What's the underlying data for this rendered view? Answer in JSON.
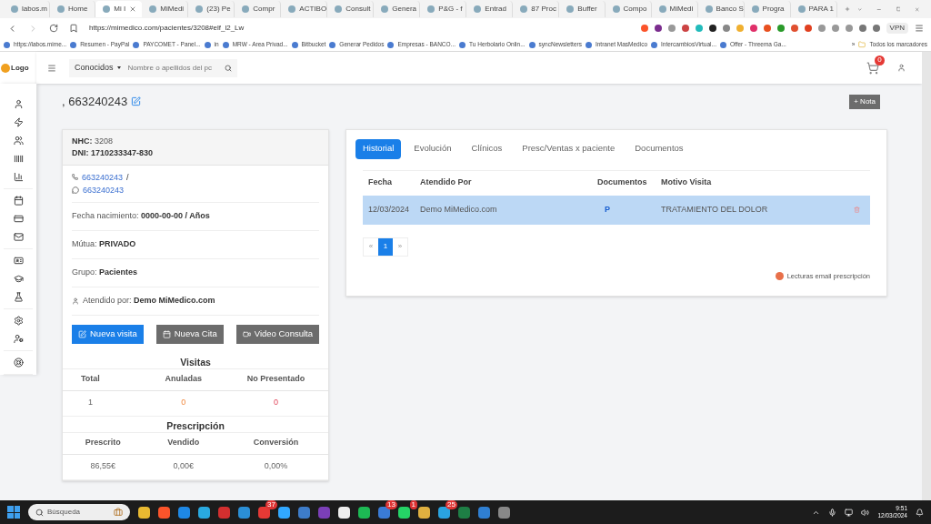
{
  "browser": {
    "tabs": [
      {
        "label": "labos.m",
        "selected": false
      },
      {
        "label": "Home",
        "selected": false
      },
      {
        "label": "Mi I",
        "selected": true
      },
      {
        "label": "MiMedi",
        "selected": false
      },
      {
        "label": "(23) Pe",
        "selected": false
      },
      {
        "label": "Compr",
        "selected": false
      },
      {
        "label": "ACTIBO",
        "selected": false
      },
      {
        "label": "Consult",
        "selected": false
      },
      {
        "label": "Genera",
        "selected": false
      },
      {
        "label": "P&G - f",
        "selected": false
      },
      {
        "label": "Entrad",
        "selected": false
      },
      {
        "label": "87 Proc",
        "selected": false
      },
      {
        "label": "Buffer",
        "selected": false
      },
      {
        "label": "Compo",
        "selected": false
      },
      {
        "label": "MiMedi",
        "selected": false
      },
      {
        "label": "Banco S",
        "selected": false
      },
      {
        "label": "Progra",
        "selected": false
      },
      {
        "label": "PARA 1",
        "selected": false
      }
    ],
    "url": "https://mimedico.com/pacientes/3208#elf_l2_Lw",
    "vpn": "VPN",
    "bookmarks": [
      {
        "label": "https://labos.mime..."
      },
      {
        "label": "Resumen - PayPal"
      },
      {
        "label": "PAYCOMET - Panel..."
      },
      {
        "label": "in"
      },
      {
        "label": "MRW - Area Privad..."
      },
      {
        "label": "Bitbucket"
      },
      {
        "label": "Generar Pedidos"
      },
      {
        "label": "Empresas - BANCO..."
      },
      {
        "label": "Tu Herbolario Onlin..."
      },
      {
        "label": "syncNewsletters"
      },
      {
        "label": "Intranet MasMedico"
      },
      {
        "label": "IntercambiosVirtual..."
      },
      {
        "label": "Offer - Threema Ga..."
      }
    ],
    "more": "»",
    "all_bookmarks": "Todos los marcadores"
  },
  "app": {
    "logo": "Logo",
    "filter": "Conocidos",
    "search_placeholder": "Nombre o apellidos del pc",
    "cart_badge": "0",
    "title": ", 663240243",
    "note_button": "+ Nota",
    "patient": {
      "nhc_label": "NHC:",
      "nhc": "3208",
      "dni": "DNI: 1710233347-830",
      "phone": "663240243",
      "separator": "/",
      "whatsapp": "663240243",
      "fields": [
        {
          "label": "Fecha nacimiento:",
          "value": "0000-00-00 / Años"
        },
        {
          "label": "Mútua:",
          "value": "PRIVADO"
        },
        {
          "label": "Grupo:",
          "value": "Pacientes"
        },
        {
          "label": "Atendido por:",
          "value": "Demo MiMedico.com"
        }
      ],
      "buttons": [
        {
          "label": "Nueva visita",
          "kind": "primary"
        },
        {
          "label": "Nueva Cita",
          "kind": "calendar"
        },
        {
          "label": "Video Consulta",
          "kind": "video"
        }
      ]
    },
    "stats": [
      {
        "title": "Visitas",
        "columns": [
          "Total",
          "Anuladas",
          "No Presentado"
        ],
        "values": [
          {
            "text": "1",
            "kind": "neutral"
          },
          {
            "text": "0",
            "kind": "cancelled"
          },
          {
            "text": "0",
            "kind": "missed"
          }
        ]
      },
      {
        "title": "Prescripción",
        "columns": [
          "Prescrito",
          "Vendido",
          "Conversión"
        ],
        "values": [
          {
            "text": "86,55€",
            "kind": "neutral"
          },
          {
            "text": "0,00€",
            "kind": "neutral"
          },
          {
            "text": "0,00%",
            "kind": "neutral"
          }
        ]
      }
    ],
    "tabs": [
      {
        "label": "Historial",
        "selected": true
      },
      {
        "label": "Evolución",
        "selected": false
      },
      {
        "label": "Clínicos",
        "selected": false
      },
      {
        "label": "Presc/Ventas x paciente",
        "selected": false
      },
      {
        "label": "Documentos",
        "selected": false
      }
    ],
    "table": {
      "columns": [
        "Fecha",
        "Atendido Por",
        "Documentos",
        "Motivo Visita"
      ],
      "rows": [
        {
          "date": "12/03/2024",
          "attended": "Demo MiMedico.com",
          "document": "P",
          "reason": "TRATAMIENTO DEL DOLOR",
          "selected": true
        }
      ]
    },
    "pagination": [
      {
        "label": "«",
        "selected": false
      },
      {
        "label": "1",
        "selected": true
      },
      {
        "label": "»",
        "selected": false
      }
    ],
    "legend": "Lecturas email prescripción"
  },
  "taskbar": {
    "search": "Búsqueda",
    "apps": [
      {
        "color": "#e8b931"
      },
      {
        "color": "#fb542b"
      },
      {
        "color": "#1e88e5"
      },
      {
        "color": "#29a9e0"
      },
      {
        "color": "#d32f2f"
      },
      {
        "color": "#2b8fd6"
      },
      {
        "color": "#e53935",
        "badge": "37"
      },
      {
        "color": "#31a8ff"
      },
      {
        "color": "#3d7cc9"
      },
      {
        "color": "#7b3fb8"
      },
      {
        "color": "#eeeeee"
      },
      {
        "color": "#1db954"
      },
      {
        "color": "#3a7bd5",
        "badge": "13"
      },
      {
        "color": "#25d366",
        "badge": "1"
      },
      {
        "color": "#e0b040"
      },
      {
        "color": "#2aa3e0",
        "badge": "25"
      },
      {
        "color": "#1e7e45"
      },
      {
        "color": "#2f7fd2"
      },
      {
        "color": "#888888"
      }
    ],
    "time": "9:51",
    "date": "12/03/2024"
  }
}
